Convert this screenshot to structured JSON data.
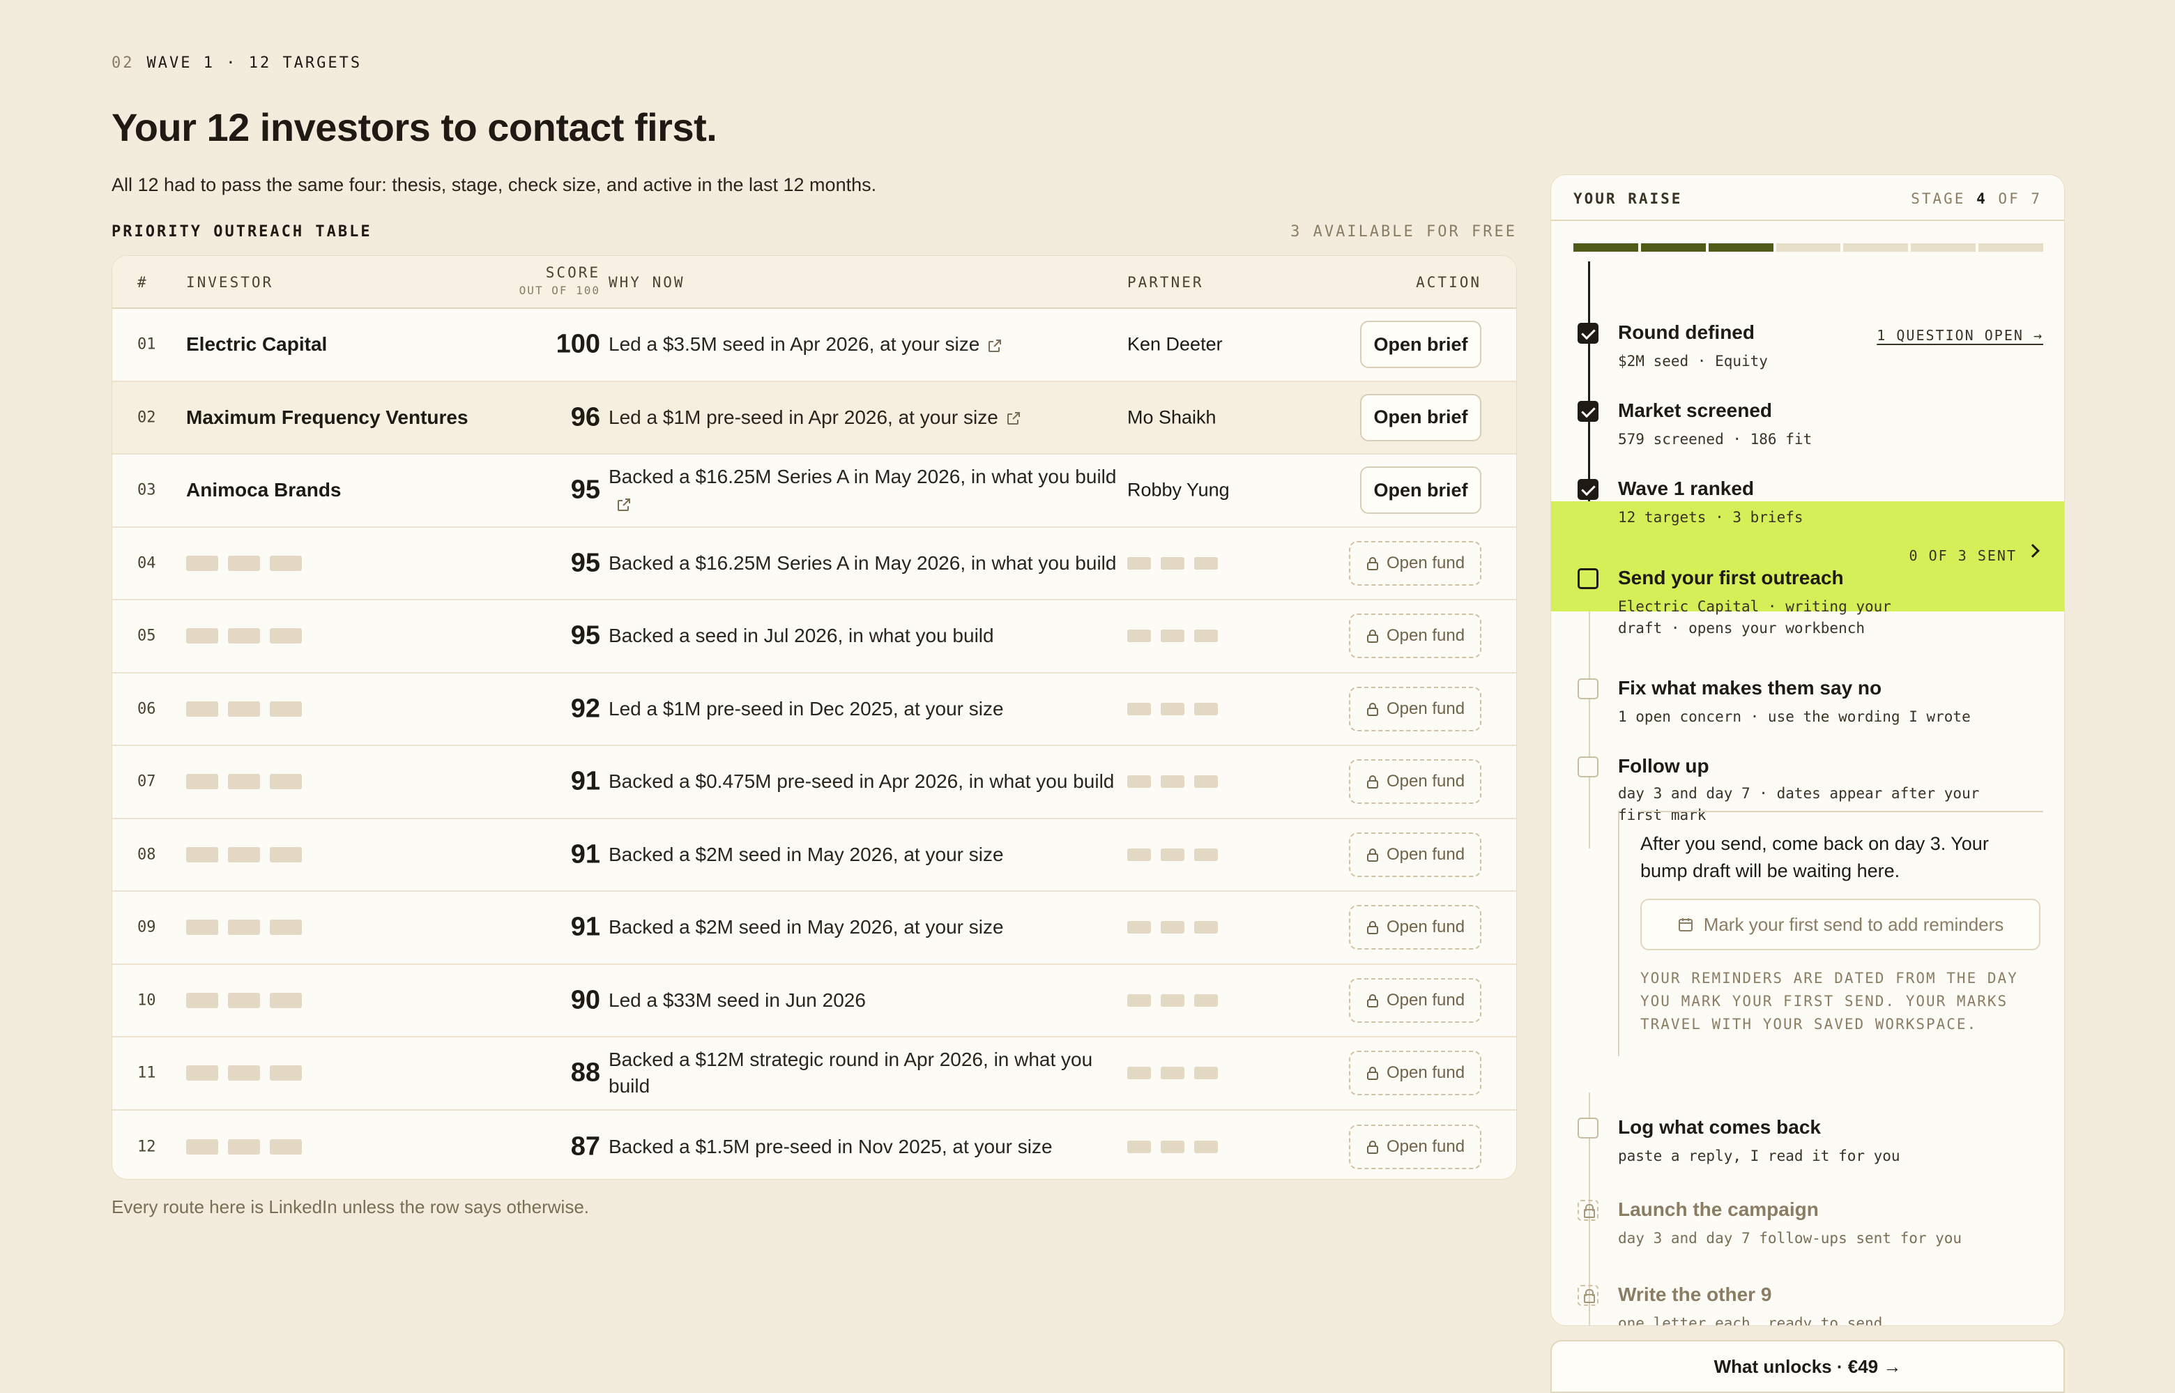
{
  "header": {
    "step_num": "02",
    "eyebrow": "WAVE 1 · 12 TARGETS",
    "title": "Your 12 investors to contact first.",
    "subtitle": "All 12 had to pass the same four: thesis, stage, check size, and active in the last 12 months."
  },
  "table": {
    "label": "PRIORITY OUTREACH TABLE",
    "available": "3 AVAILABLE FOR FREE",
    "columns": {
      "num": "#",
      "investor": "INVESTOR",
      "score": "SCORE",
      "score_sub": "OUT OF 100",
      "why": "WHY NOW",
      "partner": "PARTNER",
      "action": "ACTION"
    },
    "rows": [
      {
        "num": "01",
        "investor": "Electric Capital",
        "score": "100",
        "why": "Led a $3.5M seed in Apr 2026, at your size",
        "partner": "Ken Deeter",
        "action": "Open brief"
      },
      {
        "num": "02",
        "investor": "Maximum Frequency Ventures",
        "score": "96",
        "why": "Led a $1M pre-seed in Apr 2026, at your size",
        "partner": "Mo Shaikh",
        "action": "Open brief"
      },
      {
        "num": "03",
        "investor": "Animoca Brands",
        "score": "95",
        "why": "Backed a $16.25M Series A in May 2026, in what you build",
        "partner": "Robby Yung",
        "action": "Open brief"
      },
      {
        "num": "04",
        "score": "95",
        "why": "Backed a $16.25M Series A in May 2026, in what you build",
        "action": "Open fund"
      },
      {
        "num": "05",
        "score": "95",
        "why": "Backed a seed in Jul 2026, in what you build",
        "action": "Open fund"
      },
      {
        "num": "06",
        "score": "92",
        "why": "Led a $1M pre-seed in Dec 2025, at your size",
        "action": "Open fund"
      },
      {
        "num": "07",
        "score": "91",
        "why": "Backed a $0.475M pre-seed in Apr 2026, in what you build",
        "action": "Open fund"
      },
      {
        "num": "08",
        "score": "91",
        "why": "Backed a $2M seed in May 2026, at your size",
        "action": "Open fund"
      },
      {
        "num": "09",
        "score": "91",
        "why": "Backed a $2M seed in May 2026, at your size",
        "action": "Open fund"
      },
      {
        "num": "10",
        "score": "90",
        "why": "Led a $33M seed in Jun 2026",
        "action": "Open fund"
      },
      {
        "num": "11",
        "score": "88",
        "why": "Backed a $12M strategic round in Apr 2026, in what you build",
        "action": "Open fund"
      },
      {
        "num": "12",
        "score": "87",
        "why": "Backed a $1.5M pre-seed in Nov 2025, at your size",
        "action": "Open fund"
      }
    ],
    "footnote": "Every route here is LinkedIn unless the row says otherwise."
  },
  "panel": {
    "title": "YOUR RAISE",
    "stage_prefix": "STAGE",
    "stage_current": "4",
    "stage_suffix": "OF 7",
    "progress": {
      "filled": 3,
      "total": 7
    },
    "steps": [
      {
        "title": "Round defined",
        "sub": "$2M seed · Equity",
        "link": "1 QUESTION OPEN →",
        "state": "done"
      },
      {
        "title": "Market screened",
        "sub": "579 screened · 186 fit",
        "state": "done"
      },
      {
        "title": "Wave 1 ranked",
        "sub": "12 targets · 3 briefs",
        "state": "done"
      },
      {
        "title": "Send your first outreach",
        "sub": "Electric Capital · writing your draft · opens your workbench",
        "count": "0 OF 3 SENT",
        "state": "active"
      },
      {
        "title": "Fix what makes them say no",
        "sub": "1 open concern · use the wording I wrote",
        "state": "todo"
      },
      {
        "title": "Follow up",
        "sub": "day 3 and day 7 · dates appear after your first mark",
        "state": "todo"
      },
      {
        "title": "Log what comes back",
        "sub": "paste a reply, I read it for you",
        "state": "todo"
      },
      {
        "title": "Launch the campaign",
        "sub": "day 3 and day 7 follow-ups sent for you",
        "state": "locked"
      },
      {
        "title": "Write the other 9",
        "sub": "one letter each, ready to send",
        "state": "locked"
      }
    ],
    "note": {
      "text": "After you send, come back on day 3. Your bump draft will be waiting here.",
      "button": "Mark your first send to add reminders",
      "mono": "YOUR REMINDERS ARE DATED FROM THE DAY YOU MARK YOUR FIRST SEND. YOUR MARKS TRAVEL WITH YOUR SAVED WORKSPACE."
    },
    "unlock_button": "What unlocks · €49 →"
  }
}
